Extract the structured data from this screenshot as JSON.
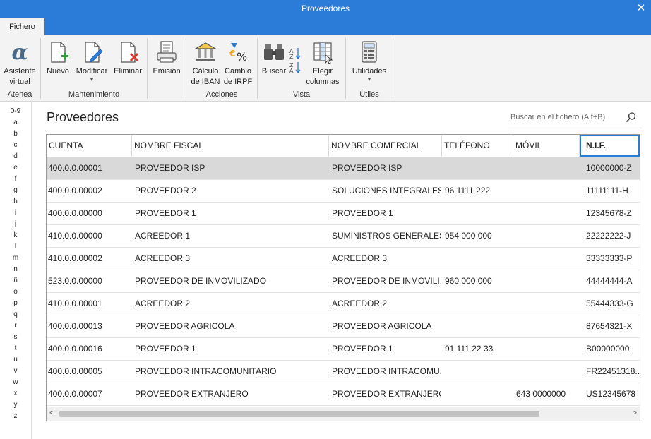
{
  "window": {
    "title": "Proveedores",
    "close": "✕"
  },
  "tabs": [
    {
      "label": "Fichero"
    }
  ],
  "ribbon": {
    "groups": [
      {
        "label": "Atenea"
      },
      {
        "label": "Mantenimiento"
      },
      {
        "label": "Acciones"
      },
      {
        "label": "Vista"
      },
      {
        "label": "Útiles"
      }
    ],
    "buttons": {
      "asistente": [
        "Asistente",
        "virtual"
      ],
      "nuevo": [
        "Nuevo"
      ],
      "modificar": [
        "Modificar"
      ],
      "eliminar": [
        "Eliminar"
      ],
      "emision": [
        "Emisión"
      ],
      "iban": [
        "Cálculo",
        "de IBAN"
      ],
      "irpf": [
        "Cambio",
        "de IRPF"
      ],
      "buscar": [
        "Buscar"
      ],
      "columnas": [
        "Elegir",
        "columnas"
      ],
      "utilidades": [
        "Utilidades"
      ]
    }
  },
  "alpha_index": [
    "0-9",
    "a",
    "b",
    "c",
    "d",
    "e",
    "f",
    "g",
    "h",
    "i",
    "j",
    "k",
    "l",
    "m",
    "n",
    "ñ",
    "o",
    "p",
    "q",
    "r",
    "s",
    "t",
    "u",
    "v",
    "w",
    "x",
    "y",
    "z"
  ],
  "main": {
    "title": "Proveedores",
    "search_placeholder": "Buscar en el fichero (Alt+B)"
  },
  "table": {
    "columns": [
      "CUENTA",
      "NOMBRE FISCAL",
      "NOMBRE COMERCIAL",
      "TELÉFONO",
      "MÓVIL",
      "N.I.F."
    ],
    "rows": [
      [
        "400.0.0.00001",
        "PROVEEDOR ISP",
        "PROVEEDOR ISP",
        "",
        "",
        "10000000-Z"
      ],
      [
        "400.0.0.00002",
        "PROVEEDOR 2",
        "SOLUCIONES INTEGRALES,...",
        "96 1111 222",
        "",
        "11111111-H"
      ],
      [
        "400.0.0.00000",
        "PROVEEDOR 1",
        "PROVEEDOR 1",
        "",
        "",
        "12345678-Z"
      ],
      [
        "410.0.0.00000",
        "ACREEDOR 1",
        "SUMINISTROS GENERALES",
        "954 000 000",
        "",
        "22222222-J"
      ],
      [
        "410.0.0.00002",
        "ACREEDOR 3",
        "ACREEDOR 3",
        "",
        "",
        "33333333-P"
      ],
      [
        "523.0.0.00000",
        "PROVEEDOR DE INMOVILIZADO",
        "PROVEEDOR DE INMOVILI...",
        "960 000 000",
        "",
        "44444444-A"
      ],
      [
        "410.0.0.00001",
        "ACREEDOR 2",
        "ACREEDOR 2",
        "",
        "",
        "55444333-G"
      ],
      [
        "400.0.0.00013",
        "PROVEEDOR AGRICOLA",
        "PROVEEDOR AGRICOLA",
        "",
        "",
        "87654321-X"
      ],
      [
        "400.0.0.00016",
        "PROVEEDOR 1",
        "PROVEEDOR 1",
        "91 111 22 33",
        "",
        "B00000000"
      ],
      [
        "400.0.0.00005",
        "PROVEEDOR INTRACOMUNITARIO",
        "PROVEEDOR INTRACOMU...",
        "",
        "",
        "FR22451318..."
      ],
      [
        "400.0.0.00007",
        "PROVEEDOR EXTRANJERO",
        "PROVEEDOR EXTRANJERO",
        "",
        "643 0000000",
        "US12345678"
      ]
    ]
  },
  "scrollbar": {
    "left_arrow": "<",
    "right_arrow": ">"
  },
  "colors": {
    "accent": "#2b7bd9",
    "selected_row": "#d9d9d9",
    "ribbon_bg": "#f3f3f3"
  }
}
